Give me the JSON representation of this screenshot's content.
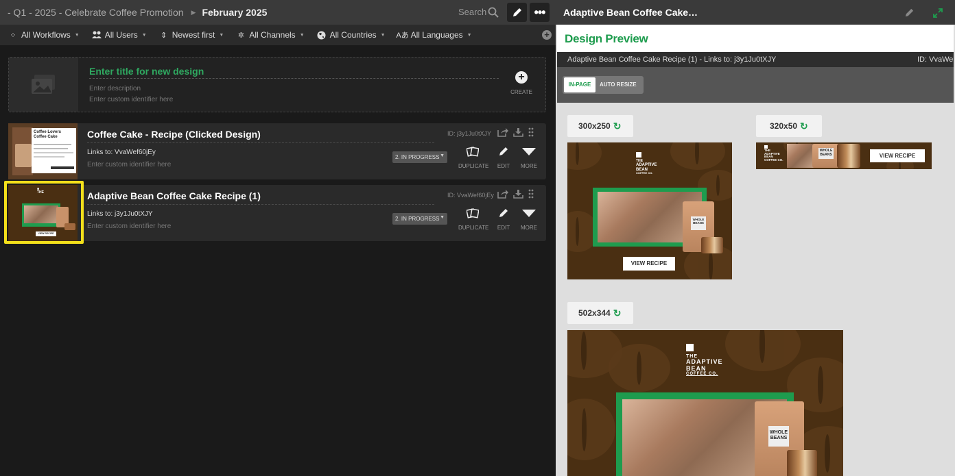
{
  "topbar": {
    "breadcrumb_parent": "- Q1 - 2025 - Celebrate Coffee Promotion",
    "breadcrumb_current": "February 2025",
    "search_label": "Search",
    "more_glyph": "•••"
  },
  "filters": [
    {
      "label": "All Workflows",
      "icon": "workflow-icon"
    },
    {
      "label": "All Users",
      "icon": "users-icon"
    },
    {
      "label": "Newest first",
      "icon": "sort-icon"
    },
    {
      "label": "All Channels",
      "icon": "channels-icon"
    },
    {
      "label": "All Countries",
      "icon": "globe-icon"
    },
    {
      "label": "All Languages",
      "icon": "language-icon"
    }
  ],
  "new_design": {
    "title_placeholder": "Enter title for new design",
    "description_placeholder": "Enter description",
    "identifier_placeholder": "Enter custom identifier here",
    "create_label": "CREATE"
  },
  "designs": [
    {
      "title": "Coffee Cake - Recipe (Clicked Design)",
      "links": "Links to: VvaWef60jEy",
      "identifier_placeholder": "Enter custom identifier here",
      "id": "ID:  j3y1Ju0tXJY",
      "status": "2. IN PROGRESS",
      "thumb_title": "Coffee Lovers Coffee Cake"
    },
    {
      "title": "Adaptive Bean Coffee Cake Recipe (1)",
      "links": "Links to: j3y1Ju0tXJY",
      "identifier_placeholder": "Enter custom identifier here",
      "id": "ID:  VvaWef60jEy",
      "status": "2. IN PROGRESS",
      "thumb_button": "VIEW RECIPE"
    }
  ],
  "actions": {
    "duplicate": "DUPLICATE",
    "edit": "EDIT",
    "more": "MORE"
  },
  "preview": {
    "panel_title": "Adaptive Bean Coffee Cake…",
    "heading": "Design Preview",
    "info": "Adaptive Bean Coffee Cake Recipe (1) - Links to: j3y1Ju0tXJY",
    "info_id": "ID: VvaWe",
    "mode_inpage": "IN-PAGE",
    "mode_auto": "AUTO RESIZE",
    "sizes": [
      "300x250",
      "320x50",
      "502x344"
    ],
    "ad_logo_lines": [
      "THE",
      "ADAPTIVE",
      "BEAN",
      "COFFEE CO."
    ],
    "ad_bag_lines": [
      "WHOLE",
      "BEANS"
    ],
    "ad_button": "VIEW RECIPE"
  },
  "colors": {
    "accent_green": "#1e9c4e",
    "highlight_yellow": "#f4e01b",
    "ad_brown": "#4a2f12"
  }
}
